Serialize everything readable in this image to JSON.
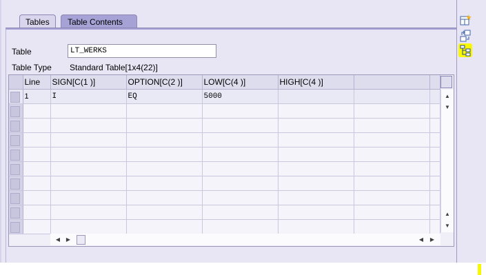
{
  "tabs": [
    {
      "label": "Tables",
      "active": false
    },
    {
      "label": "Table Contents",
      "active": true
    }
  ],
  "form": {
    "table_label": "Table",
    "table_value": "LT_WERKS",
    "table_type_label": "Table Type",
    "table_type_value": "Standard Table[1x4(22)]"
  },
  "grid": {
    "columns": [
      "Line",
      "SIGN[C(1 )]",
      "OPTION[C(2 )]",
      "LOW[C(4 )]",
      "HIGH[C(4 )]",
      ""
    ],
    "rows": [
      [
        "1",
        "I",
        "EQ",
        "5000",
        "",
        ""
      ]
    ],
    "empty_row_count": 9
  },
  "toolbar": {
    "icons": [
      "new-table-icon",
      "transfer-icon",
      "structure-tree-icon"
    ]
  },
  "colors": {
    "background": "#e8e6f4",
    "active_tab": "#a6a2d6",
    "highlight": "#f8f800"
  }
}
